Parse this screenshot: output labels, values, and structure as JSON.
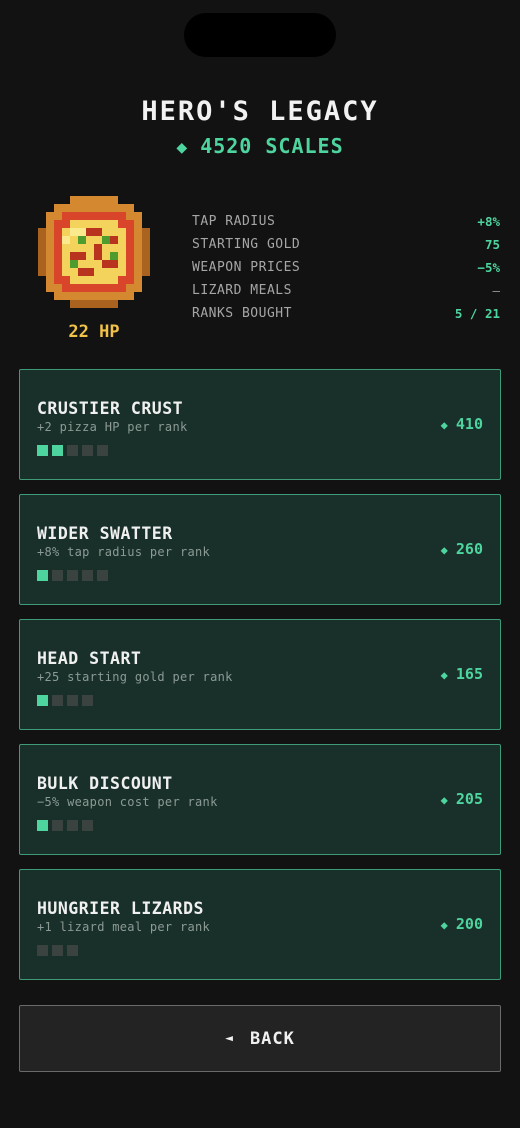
{
  "header": {
    "title": "HERO'S LEGACY",
    "currency_icon": "◆",
    "currency_text": "4520 SCALES"
  },
  "hero": {
    "icon": "pizza-icon",
    "hp_text": "22 HP"
  },
  "stats": [
    {
      "label": "TAP RADIUS",
      "value": "+8%"
    },
    {
      "label": "STARTING GOLD",
      "value": "75"
    },
    {
      "label": "WEAPON PRICES",
      "value": "−5%"
    },
    {
      "label": "LIZARD MEALS",
      "value": "—"
    },
    {
      "label": "RANKS BOUGHT",
      "value": "5 / 21"
    }
  ],
  "upgrades": [
    {
      "name": "CRUSTIER CRUST",
      "desc": "+2 pizza HP per rank",
      "price_icon": "◆",
      "price": "410",
      "ranks_owned": 2,
      "ranks_max": 5
    },
    {
      "name": "WIDER SWATTER",
      "desc": "+8% tap radius per rank",
      "price_icon": "◆",
      "price": "260",
      "ranks_owned": 1,
      "ranks_max": 5
    },
    {
      "name": "HEAD START",
      "desc": "+25 starting gold per rank",
      "price_icon": "◆",
      "price": "165",
      "ranks_owned": 1,
      "ranks_max": 4
    },
    {
      "name": "BULK DISCOUNT",
      "desc": "−5% weapon cost per rank",
      "price_icon": "◆",
      "price": "205",
      "ranks_owned": 1,
      "ranks_max": 4
    },
    {
      "name": "HUNGRIER LIZARDS",
      "desc": "+1 lizard meal per rank",
      "price_icon": "◆",
      "price": "200",
      "ranks_owned": 0,
      "ranks_max": 3
    }
  ],
  "back": {
    "icon": "◄",
    "label": "BACK"
  },
  "colors": {
    "background": "#121212",
    "accent": "#4ed59f",
    "hp": "#f0c24a",
    "card_bg": "#19302a",
    "card_border": "#3f9a78"
  }
}
